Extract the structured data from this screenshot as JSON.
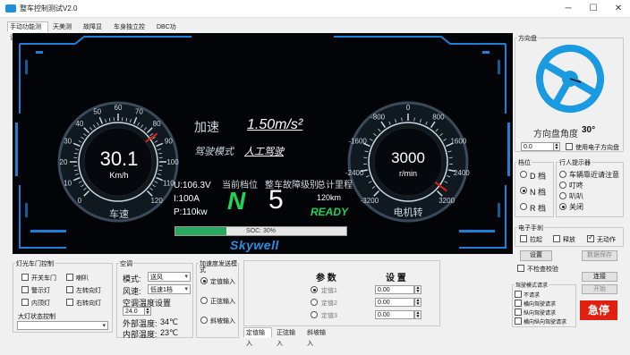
{
  "window": {
    "title": "整车控制测试V2.0",
    "minimize": "─",
    "maximize": "☐",
    "close": "✕"
  },
  "tabs": [
    "手动功能测试",
    "天美测试",
    "故障显示",
    "车身独立控制",
    "DBC功能"
  ],
  "dashboard": {
    "speedo": {
      "value": "30.1",
      "unit": "Km/h",
      "label": "车速",
      "ticks": [
        "0",
        "10",
        "20",
        "30",
        "40",
        "50",
        "60",
        "70",
        "80",
        "90",
        "100",
        "110",
        "120"
      ],
      "needle_fraction": 0.7
    },
    "tacho": {
      "value": "3000",
      "unit": "r/min",
      "label": "电机转",
      "ticks": [
        "-3200",
        "-2400",
        "-1600",
        "-800",
        "0",
        "800",
        "1600",
        "2400",
        "3200"
      ],
      "needle_fraction": 0.97
    },
    "accel_label": "加速",
    "accel_value": "1.50m/s²",
    "drive_mode_label": "驾驶模式",
    "drive_mode_value": "人工驾驶",
    "current_gear_label": "当前档位",
    "fault_level_label": "整车故障级别",
    "mileage_label": "总计里程",
    "voltage": "U:106.3V",
    "current": "I:100A",
    "power": "P:110kw",
    "gear": "N",
    "fault_level": "5",
    "mileage": "120km",
    "ready": "READY",
    "soc_text": "SOC: 30%",
    "soc_percent": 30,
    "brand": "Skywell",
    "colors": {
      "green": "#1fd25a",
      "frame": "#1e7fd6",
      "needle": "#e02010"
    }
  },
  "steering": {
    "group_title": "方向盘",
    "angle_label": "方向盘角度",
    "angle_value": "30°",
    "input_value": "0.0",
    "use_electric_label": "使用电子方向盘",
    "use_electric_checked": false
  },
  "gear_panel": {
    "title": "档位",
    "options": [
      "D 档",
      "N 档",
      "R 档"
    ],
    "selected": 1
  },
  "pedestrian": {
    "title": "行人提示器",
    "options": [
      "车辆靠近请注意",
      "叮咚",
      "叭叭",
      "关闭"
    ],
    "selected": 3
  },
  "handbrake": {
    "title": "电子手刹",
    "items": [
      {
        "label": "拉起",
        "checked": false
      },
      {
        "label": "释放",
        "checked": false
      },
      {
        "label": "无动作",
        "checked": true
      }
    ],
    "set_button": "设置",
    "save_button": "数据保存"
  },
  "side_controls": {
    "no_check_label": "不检查校验",
    "connect_button": "连接",
    "start_button": "开始",
    "estop_button": "急停"
  },
  "steer_mode": {
    "title": "驾驶模式请求",
    "items": [
      "不请求",
      "横向驾驶请求",
      "纵向驾驶请求",
      "横向纵向驾驶请求"
    ]
  },
  "lights": {
    "title": "灯光车门控制",
    "items": [
      {
        "label": "开关车门",
        "checked": false
      },
      {
        "label": "喇叭",
        "checked": false
      },
      {
        "label": "警示灯",
        "checked": false
      },
      {
        "label": "左转向灯",
        "checked": false
      },
      {
        "label": "内顶灯",
        "checked": false
      },
      {
        "label": "右转向灯",
        "checked": false
      }
    ],
    "headlight_title": "大灯状态控制",
    "headlight_value": ""
  },
  "ac": {
    "title": "空调",
    "mode_label": "模式:",
    "mode_value": "送风",
    "fan_label": "风速:",
    "fan_value": "低速1档",
    "temp_set_label": "空调温度设置",
    "temp_set_value": "24.0",
    "outside_label": "外部温度:",
    "outside_value": "34℃",
    "inside_label": "内部温度:",
    "inside_value": "23℃"
  },
  "speed_mode": {
    "title": "加速度发送模式",
    "options": [
      "定值输入",
      "正弦输入",
      "斜坡输入"
    ],
    "selected": 0
  },
  "params": {
    "col_param": "参  数",
    "col_set": "设  置",
    "rows": [
      {
        "label": "定值1",
        "value": "0.00"
      },
      {
        "label": "定值2",
        "value": "0.00"
      },
      {
        "label": "定值3",
        "value": "0.00"
      }
    ],
    "selected": 0,
    "bottom_tabs": [
      "定值输入",
      "正弦输入",
      "斜坡输入"
    ]
  }
}
